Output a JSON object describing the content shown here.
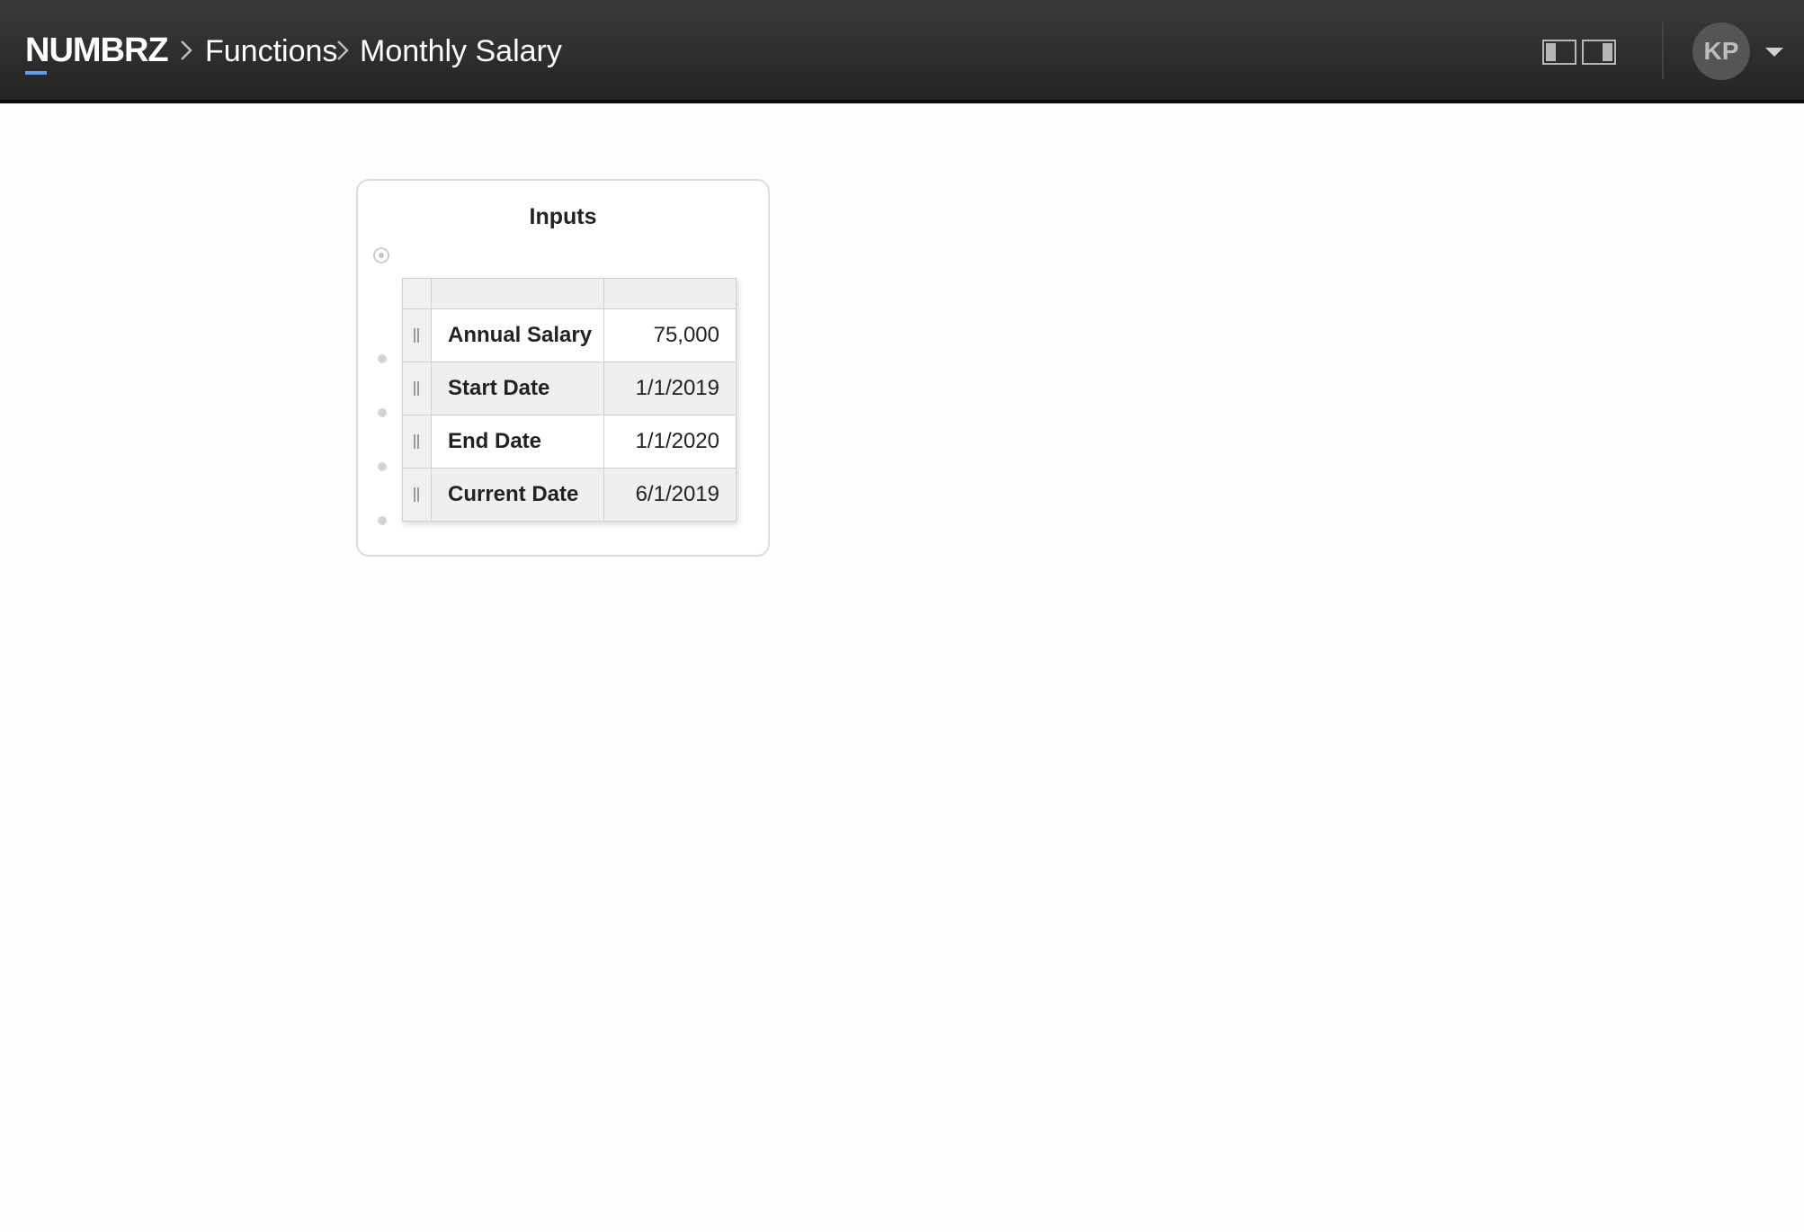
{
  "header": {
    "brand": "NUMBRZ",
    "breadcrumbs": [
      "Functions",
      "Monthly Salary"
    ],
    "avatar_initials": "KP",
    "accent_color": "#5aa0f0"
  },
  "inputs_card": {
    "title": "Inputs",
    "rows": [
      {
        "name": "Annual Salary",
        "value": "75,000"
      },
      {
        "name": "Start Date",
        "value": "1/1/2019"
      },
      {
        "name": "End Date",
        "value": "1/1/2020"
      },
      {
        "name": "Current Date",
        "value": "6/1/2019"
      }
    ]
  }
}
